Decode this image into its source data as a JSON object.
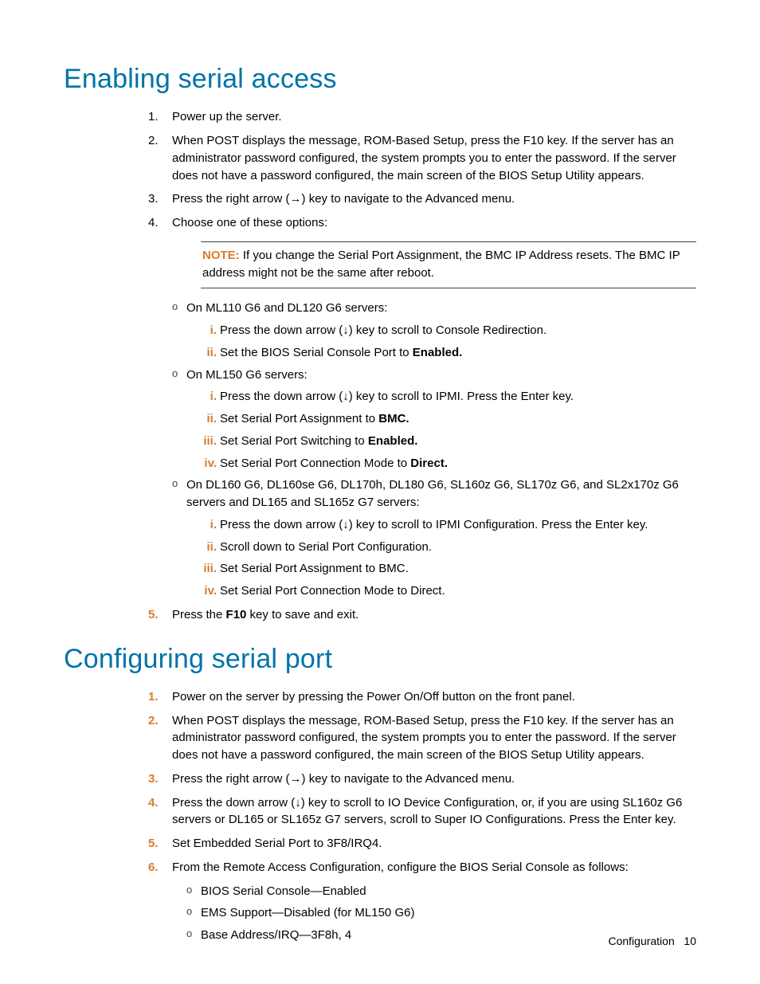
{
  "section1": {
    "title": "Enabling serial access",
    "steps": [
      {
        "marker": "1.",
        "text": "Power up the server."
      },
      {
        "marker": "2.",
        "text": "When POST displays the message, ROM-Based Setup, press the F10 key. If the server has an administrator password configured, the system prompts you to enter the password. If the server does not have a password configured, the main screen of the BIOS Setup Utility appears."
      },
      {
        "marker": "3.",
        "text": "Press the right arrow (→) key to navigate to the Advanced menu."
      },
      {
        "marker": "4.",
        "text": "Choose one of these options:"
      }
    ],
    "note_label": "NOTE:",
    "note_text": " If you change the Serial Port Assignment, the BMC IP Address resets. The BMC IP address might not be the same after reboot.",
    "group1": {
      "intro": "On ML110 G6 and DL120 G6 servers:",
      "items": [
        {
          "marker": "i.",
          "text": "Press the down arrow (↓) key to scroll to Console Redirection."
        },
        {
          "marker": "ii.",
          "pre": "Set the BIOS Serial Console Port to ",
          "bold": "Enabled."
        }
      ]
    },
    "group2": {
      "intro": "On ML150 G6 servers:",
      "items": [
        {
          "marker": "i.",
          "text": "Press the down arrow (↓) key to scroll to IPMI. Press the Enter key."
        },
        {
          "marker": "ii.",
          "pre": "Set Serial Port Assignment to ",
          "bold": "BMC."
        },
        {
          "marker": "iii.",
          "pre": "Set Serial Port Switching to ",
          "bold": "Enabled."
        },
        {
          "marker": "iv.",
          "pre": "Set Serial Port Connection Mode to ",
          "bold": "Direct."
        }
      ]
    },
    "group3": {
      "intro": "On DL160 G6, DL160se G6, DL170h, DL180 G6, SL160z G6, SL170z G6, and SL2x170z G6 servers and DL165 and SL165z G7 servers:",
      "items": [
        {
          "marker": "i.",
          "text": "Press the down arrow (↓) key to scroll to IPMI Configuration. Press the Enter key."
        },
        {
          "marker": "ii.",
          "text": "Scroll down to Serial Port Configuration."
        },
        {
          "marker": "iii.",
          "text": "Set Serial Port Assignment to BMC."
        },
        {
          "marker": "iv.",
          "text": "Set Serial Port Connection Mode to Direct."
        }
      ]
    },
    "step5": {
      "marker": "5.",
      "pre": "Press the ",
      "bold": "F10",
      "post": " key to save and exit."
    }
  },
  "section2": {
    "title": "Configuring serial port",
    "steps": [
      {
        "marker": "1.",
        "text": "Power on the server by pressing the Power On/Off button on the front panel."
      },
      {
        "marker": "2.",
        "text": "When POST displays the message, ROM-Based Setup, press the F10 key. If the server has an administrator password configured, the system prompts you to enter the password. If the server does not have a password configured, the main screen of the BIOS Setup Utility appears."
      },
      {
        "marker": "3.",
        "text": "Press the right arrow (→) key to navigate to the Advanced menu."
      },
      {
        "marker": "4.",
        "text": "Press the down arrow (↓) key to scroll to IO Device Configuration, or, if you are using SL160z G6 servers or DL165 or SL165z G7 servers, scroll to Super IO Configurations. Press the Enter key."
      },
      {
        "marker": "5.",
        "text": "Set Embedded Serial Port to 3F8/IRQ4."
      },
      {
        "marker": "6.",
        "text": "From the Remote Access Configuration, configure the BIOS Serial Console as follows:"
      }
    ],
    "sub": [
      "BIOS Serial Console—Enabled",
      "EMS Support—Disabled (for ML150 G6)",
      "Base Address/IRQ—3F8h, 4"
    ]
  },
  "footer": {
    "section": "Configuration",
    "page": "10"
  }
}
